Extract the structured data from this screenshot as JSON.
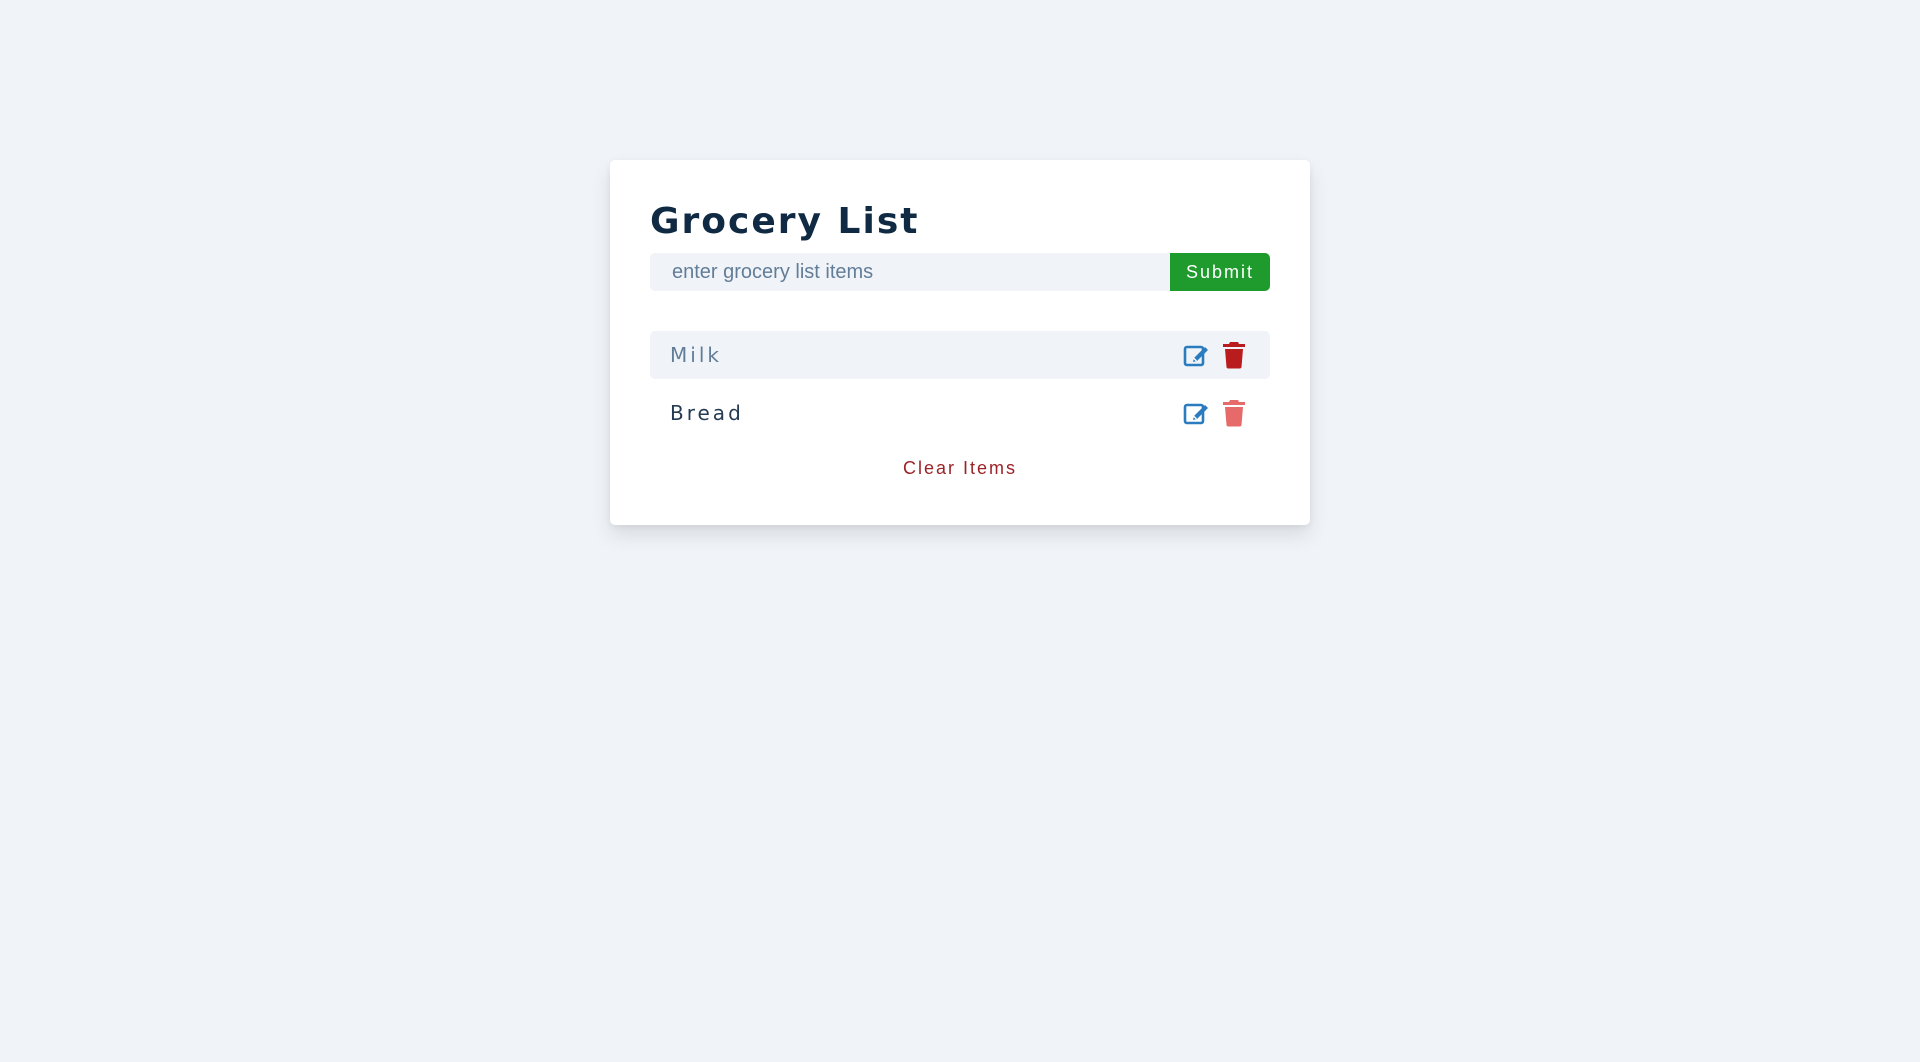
{
  "app": {
    "title": "Grocery List"
  },
  "form": {
    "placeholder": "enter grocery list items",
    "value": "",
    "submit_label": "Submit"
  },
  "items": [
    {
      "label": "Milk",
      "edit_icon": "edit-icon",
      "delete_icon": "trash-icon"
    },
    {
      "label": "Bread",
      "edit_icon": "edit-icon",
      "delete_icon": "trash-icon"
    }
  ],
  "actions": {
    "clear_label": "Clear Items"
  },
  "colors": {
    "background": "#f0f4f8",
    "title": "#102a43",
    "submit": "#1f9a2d",
    "edit_icon": "#2b7bbf",
    "delete_icon_primary": "#b91c1c",
    "delete_icon_secondary": "#e66a6a",
    "clear_text": "#9b2226"
  }
}
